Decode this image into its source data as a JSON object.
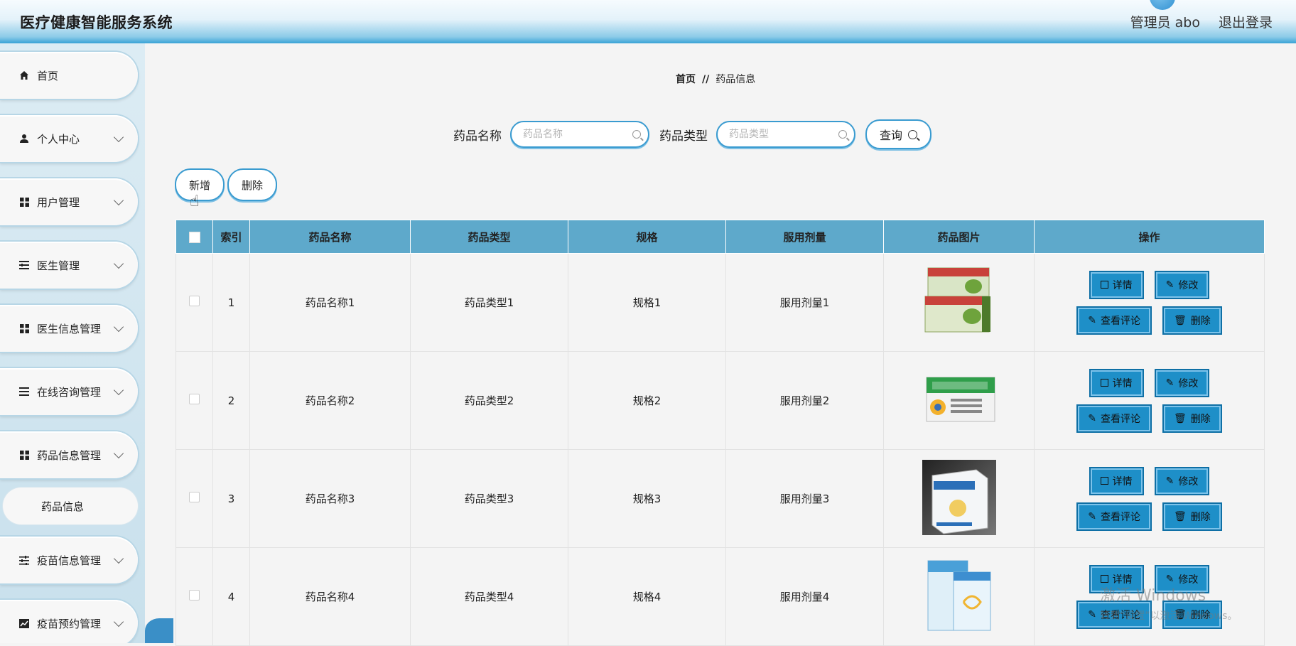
{
  "app": {
    "title": "医疗健康智能服务系统",
    "user_label": "管理员 abo",
    "logout_label": "退出登录"
  },
  "sidebar": {
    "items": [
      {
        "label": "首页",
        "icon": "home-icon",
        "has_chevron": false
      },
      {
        "label": "个人中心",
        "icon": "user-icon",
        "has_chevron": true
      },
      {
        "label": "用户管理",
        "icon": "grid-icon",
        "has_chevron": true
      },
      {
        "label": "医生管理",
        "icon": "list-icon",
        "has_chevron": true
      },
      {
        "label": "医生信息管理",
        "icon": "grid-icon",
        "has_chevron": true
      },
      {
        "label": "在线咨询管理",
        "icon": "menu-icon",
        "has_chevron": true
      },
      {
        "label": "药品信息管理",
        "icon": "grid-icon",
        "has_chevron": true
      },
      {
        "label": "疫苗信息管理",
        "icon": "sliders-icon",
        "has_chevron": true
      },
      {
        "label": "疫苗预约管理",
        "icon": "chart-icon",
        "has_chevron": true
      }
    ],
    "subitem": {
      "label": "药品信息"
    }
  },
  "breadcrumb": {
    "home": "首页",
    "separator": "//",
    "current": "药品信息"
  },
  "search": {
    "name_label": "药品名称",
    "name_placeholder": "药品名称",
    "type_label": "药品类型",
    "type_placeholder": "药品类型",
    "query_label": "查询"
  },
  "actions": {
    "add_label": "新增",
    "delete_label": "删除"
  },
  "table": {
    "headers": [
      "索引",
      "药品名称",
      "药品类型",
      "规格",
      "服用剂量",
      "药品图片",
      "操作"
    ],
    "rows": [
      {
        "index": "1",
        "name": "药品名称1",
        "type": "药品类型1",
        "spec": "规格1",
        "dose": "服用剂量1"
      },
      {
        "index": "2",
        "name": "药品名称2",
        "type": "药品类型2",
        "spec": "规格2",
        "dose": "服用剂量2"
      },
      {
        "index": "3",
        "name": "药品名称3",
        "type": "药品类型3",
        "spec": "规格3",
        "dose": "服用剂量3"
      },
      {
        "index": "4",
        "name": "药品名称4",
        "type": "药品类型4",
        "spec": "规格4",
        "dose": "服用剂量4"
      }
    ],
    "row_actions": {
      "detail": "详情",
      "edit": "修改",
      "reviews": "查看评论",
      "delete": "删除"
    }
  },
  "watermark": {
    "line1": "激活 Windows",
    "line2": "转到“设置”以激活 Windows。"
  },
  "colors": {
    "header_accent": "#3aa3d6",
    "table_header": "#5ea9cb",
    "op_button": "#1e8fc8"
  }
}
